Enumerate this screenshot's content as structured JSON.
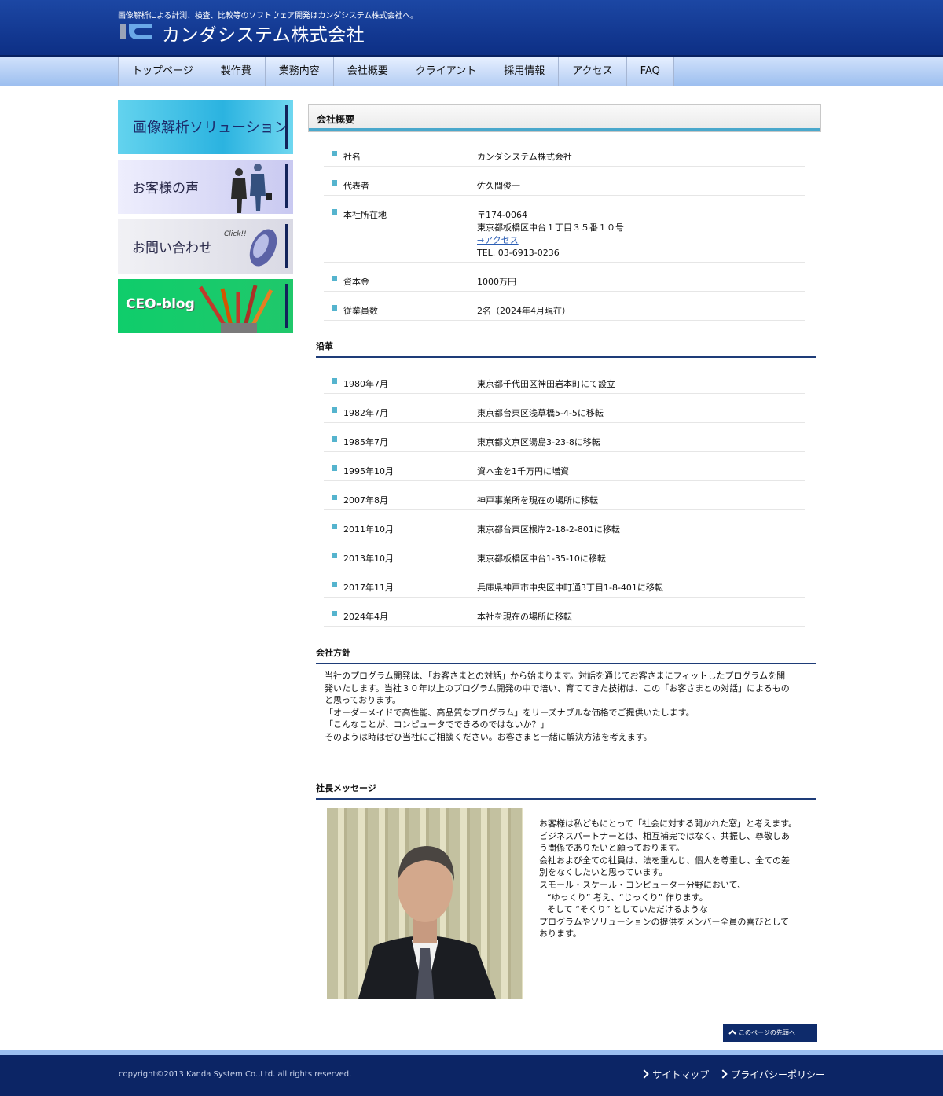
{
  "header": {
    "tagline": "画像解析による計測、検査、比較等のソフトウェア開発はカンダシステム株式会社へ。",
    "company_name": "カンダシステム株式会社",
    "colors": {
      "header_blue": "#1c47a4",
      "accent_cyan": "#4aa8cc",
      "navy": "#0c2565"
    }
  },
  "nav": {
    "items": [
      "トップページ",
      "製作費",
      "業務内容",
      "会社概要",
      "クライアント",
      "採用情報",
      "アクセス",
      "FAQ"
    ]
  },
  "sidebar": {
    "banners": [
      "画像解析ソリューション",
      "お客様の声",
      "お問い合わせ",
      "CEO-blog"
    ],
    "click_label": "Click!!"
  },
  "page": {
    "title": "会社概要"
  },
  "profile": {
    "rows": [
      {
        "label": "社名",
        "value": "カンダシステム株式会社"
      },
      {
        "label": "代表者",
        "value": "佐久間俊一"
      },
      {
        "label": "本社所在地",
        "postal": "〒174-0064",
        "address": "東京都板橋区中台１丁目３５番１０号",
        "access_link": "→アクセス",
        "tel": "TEL. 03-6913-0236"
      },
      {
        "label": "資本金",
        "value": "1000万円"
      },
      {
        "label": "従業員数",
        "value": "2名（2024年4月現在）"
      }
    ]
  },
  "history": {
    "heading": "沿革",
    "rows": [
      {
        "date": "1980年7月",
        "event": "東京都千代田区神田岩本町にて設立"
      },
      {
        "date": "1982年7月",
        "event": "東京都台東区浅草橋5-4-5に移転"
      },
      {
        "date": "1985年7月",
        "event": "東京都文京区湯島3-23-8に移転"
      },
      {
        "date": "1995年10月",
        "event": "資本金を1千万円に増資"
      },
      {
        "date": "2007年8月",
        "event": "神戸事業所を現在の場所に移転"
      },
      {
        "date": "2011年10月",
        "event": "東京都台東区根岸2-18-2-801に移転"
      },
      {
        "date": "2013年10月",
        "event": "東京都板橋区中台1-35-10に移転"
      },
      {
        "date": "2017年11月",
        "event": "兵庫県神戸市中央区中町通3丁目1-8-401に移転"
      },
      {
        "date": "2024年4月",
        "event": "本社を現在の場所に移転"
      }
    ]
  },
  "policy": {
    "heading": "会社方針",
    "lines": [
      "当社のプログラム開発は、「お客さまとの対話」から始まります。対話を通じてお客さまにフィットしたプログラムを開",
      "発いたします。当社３０年以上のプログラム開発の中で培い、育ててきた技術は、この「お客さまとの対話」によるもの",
      "と思っております。",
      "「オーダーメイドで高性能、高品質なプログラム」をリーズナブルな価格でご提供いたします。",
      "「こんなことが、コンピュータでできるのではないか？」",
      "そのようは時はぜひ当社にご相談ください。お客さまと一緒に解決方法を考えます。"
    ]
  },
  "ceo_message": {
    "heading": "社長メッセージ",
    "lines": [
      "お客様は私どもにとって「社会に対する開かれた窓」と考えます。",
      "ビジネスパートナーとは、相互補完ではなく、共振し、尊敬しあ",
      "う関係でありたいと願っております。",
      "会社および全ての社員は、法を重んじ、個人を尊重し、全ての差",
      "別をなくしたいと思っています。",
      "スモール・スケール・コンピューター分野において、",
      "“ゆっくり” 考え、“じっくり” 作ります。",
      "そして “そくり” としていただけるような",
      "プログラムやソリューションの提供をメンバー全員の喜びとして",
      "おります。"
    ]
  },
  "back_to_top": "このページの先頭へ",
  "footer": {
    "copyright": "copyright©2013 Kanda System Co.,Ltd. all rights reserved.",
    "links": [
      "サイトマップ",
      "プライバシーポリシー"
    ]
  }
}
